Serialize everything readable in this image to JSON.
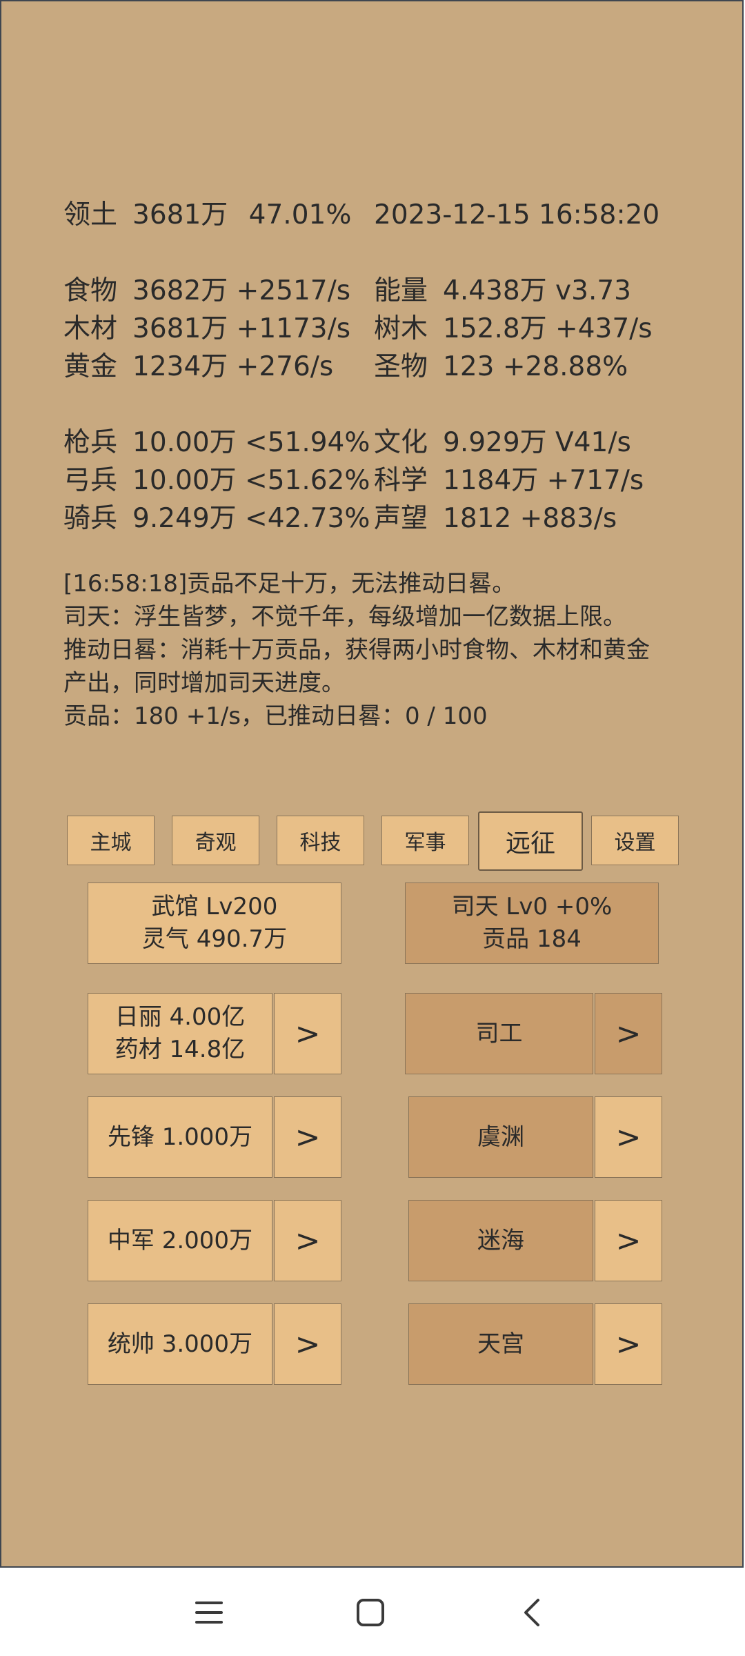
{
  "header": {
    "territory_label": "领土",
    "territory_value": "3681万",
    "territory_percent": "47.01%",
    "datetime": "2023-12-15 16:58:20"
  },
  "resources": [
    {
      "label": "食物",
      "value": "3682万 +2517/s"
    },
    {
      "label": "木材",
      "value": "3681万 +1173/s"
    },
    {
      "label": "黄金",
      "value": "1234万 +276/s"
    },
    {
      "label": "能量",
      "value": "4.438万  v3.73"
    },
    {
      "label": "树木",
      "value": "152.8万 +437/s"
    },
    {
      "label": "圣物",
      "value": "123 +28.88%"
    }
  ],
  "military": [
    {
      "label": "枪兵",
      "value": "10.00万 <51.94%"
    },
    {
      "label": "弓兵",
      "value": "10.00万 <51.62%"
    },
    {
      "label": "骑兵",
      "value": "9.249万 <42.73%"
    },
    {
      "label": "文化",
      "value": "9.929万 V41/s"
    },
    {
      "label": "科学",
      "value": "1184万 +717/s"
    },
    {
      "label": "声望",
      "value": "1812 +883/s"
    }
  ],
  "log": [
    "[16:58:18]贡品不足十万，无法推动日晷。",
    "司天：浮生皆梦，不觉千年，每级增加一亿数据上限。",
    "推动日晷：消耗十万贡品，获得两小时食物、木材和黄金",
    "产出，同时增加司天进度。",
    "贡品：180 +1/s，已推动日晷：0 / 100"
  ],
  "tabs": [
    "主城",
    "奇观",
    "科技",
    "军事",
    "远征",
    "设置"
  ],
  "active_tab": "远征",
  "panels": {
    "wuguan": {
      "line1": "武馆 Lv200",
      "line2": "灵气 490.7万"
    },
    "sitian": {
      "line1": "司天 Lv0 +0%",
      "line2": "贡品 184"
    },
    "rili": {
      "line1": "日丽  4.00亿",
      "line2": "药材 14.8亿"
    },
    "xianfeng": "先锋  1.000万",
    "zhongjun": "中军  2.000万",
    "tongshuai": "统帅  3.000万",
    "sigong": "司工",
    "yuyuan": "虞渊",
    "mihai": "迷海",
    "tiangong": "天宫",
    "arrow": ">"
  },
  "colors": {
    "background": "#c8a980",
    "button_light": "#e8bf88",
    "button_dark": "#c89c6c"
  },
  "nav_icons": [
    "menu-icon",
    "home-square-icon",
    "back-chevron-icon"
  ]
}
